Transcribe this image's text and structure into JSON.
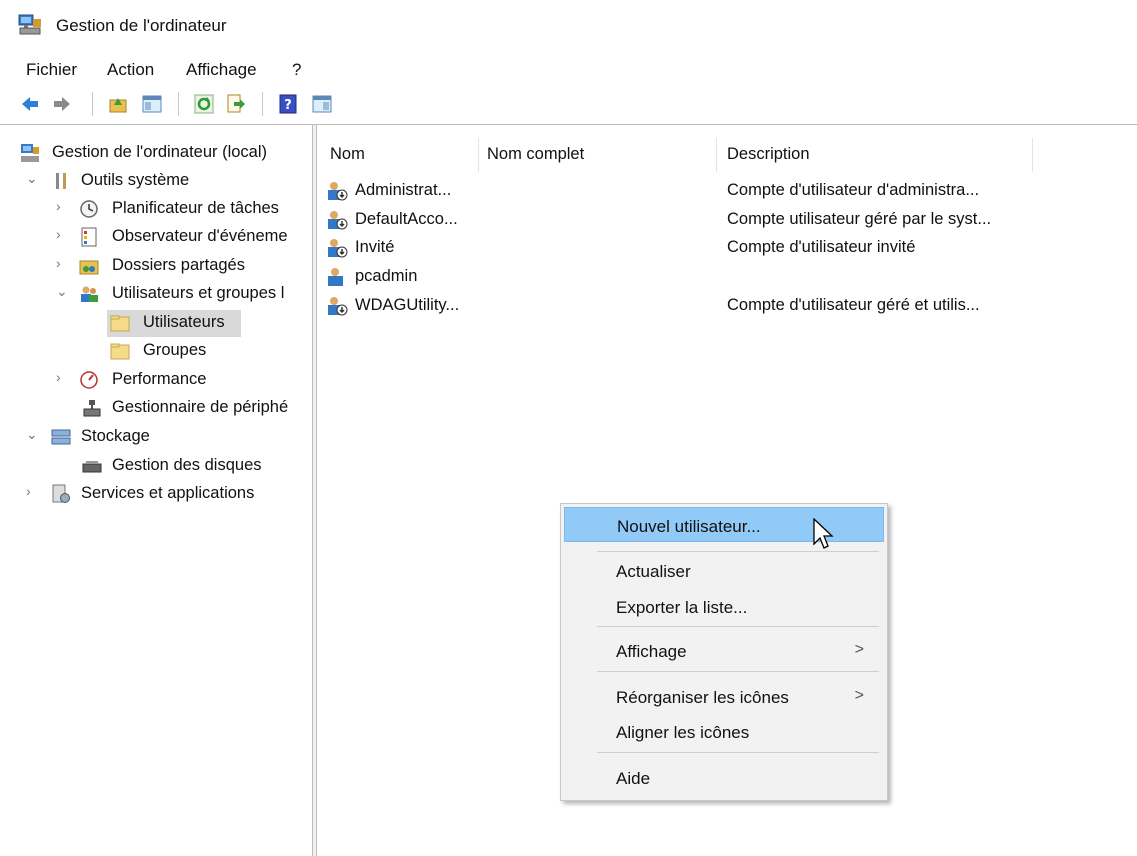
{
  "window": {
    "title": "Gestion de l'ordinateur"
  },
  "menu": {
    "items": [
      "Fichier",
      "Action",
      "Affichage",
      "?"
    ]
  },
  "toolbar": {
    "buttons": [
      "back-icon",
      "forward-icon",
      "up-folder-icon",
      "show-hide-tree-icon",
      "refresh-icon",
      "export-list-icon",
      "help-icon",
      "show-action-pane-icon"
    ]
  },
  "tree": {
    "root": "Gestion de l'ordinateur (local)",
    "outils": "Outils système",
    "planificateur": "Planificateur de tâches",
    "observateur": "Observateur d'événeme",
    "dossiers": "Dossiers partagés",
    "utilisateurs_groupes": "Utilisateurs et groupes l",
    "utilisateurs": "Utilisateurs",
    "groupes": "Groupes",
    "performance": "Performance",
    "gestionnaire": "Gestionnaire de périphé",
    "stockage": "Stockage",
    "disques": "Gestion des disques",
    "services": "Services et applications",
    "selected": "Utilisateurs"
  },
  "list": {
    "columns": [
      "Nom",
      "Nom complet",
      "Description"
    ],
    "rows": [
      {
        "name": "Administrat...",
        "fullname": "",
        "description": "Compte d'utilisateur d'administra..."
      },
      {
        "name": "DefaultAcco...",
        "fullname": "",
        "description": "Compte utilisateur géré par le syst..."
      },
      {
        "name": "Invité",
        "fullname": "",
        "description": "Compte d'utilisateur invité"
      },
      {
        "name": "pcadmin",
        "fullname": "",
        "description": ""
      },
      {
        "name": "WDAGUtility...",
        "fullname": "",
        "description": "Compte d'utilisateur géré et utilis..."
      }
    ]
  },
  "context_menu": {
    "new_user": "Nouvel utilisateur...",
    "refresh": "Actualiser",
    "export": "Exporter la liste...",
    "view": "Affichage",
    "arrange": "Réorganiser les icônes",
    "align": "Aligner les icônes",
    "help": "Aide",
    "submenu_arrow": ">",
    "highlighted": "Nouvel utilisateur..."
  },
  "colors": {
    "highlight": "#91c9f7",
    "selected_tree": "#d9d9d9",
    "menu_bg": "#f2f2f2"
  }
}
